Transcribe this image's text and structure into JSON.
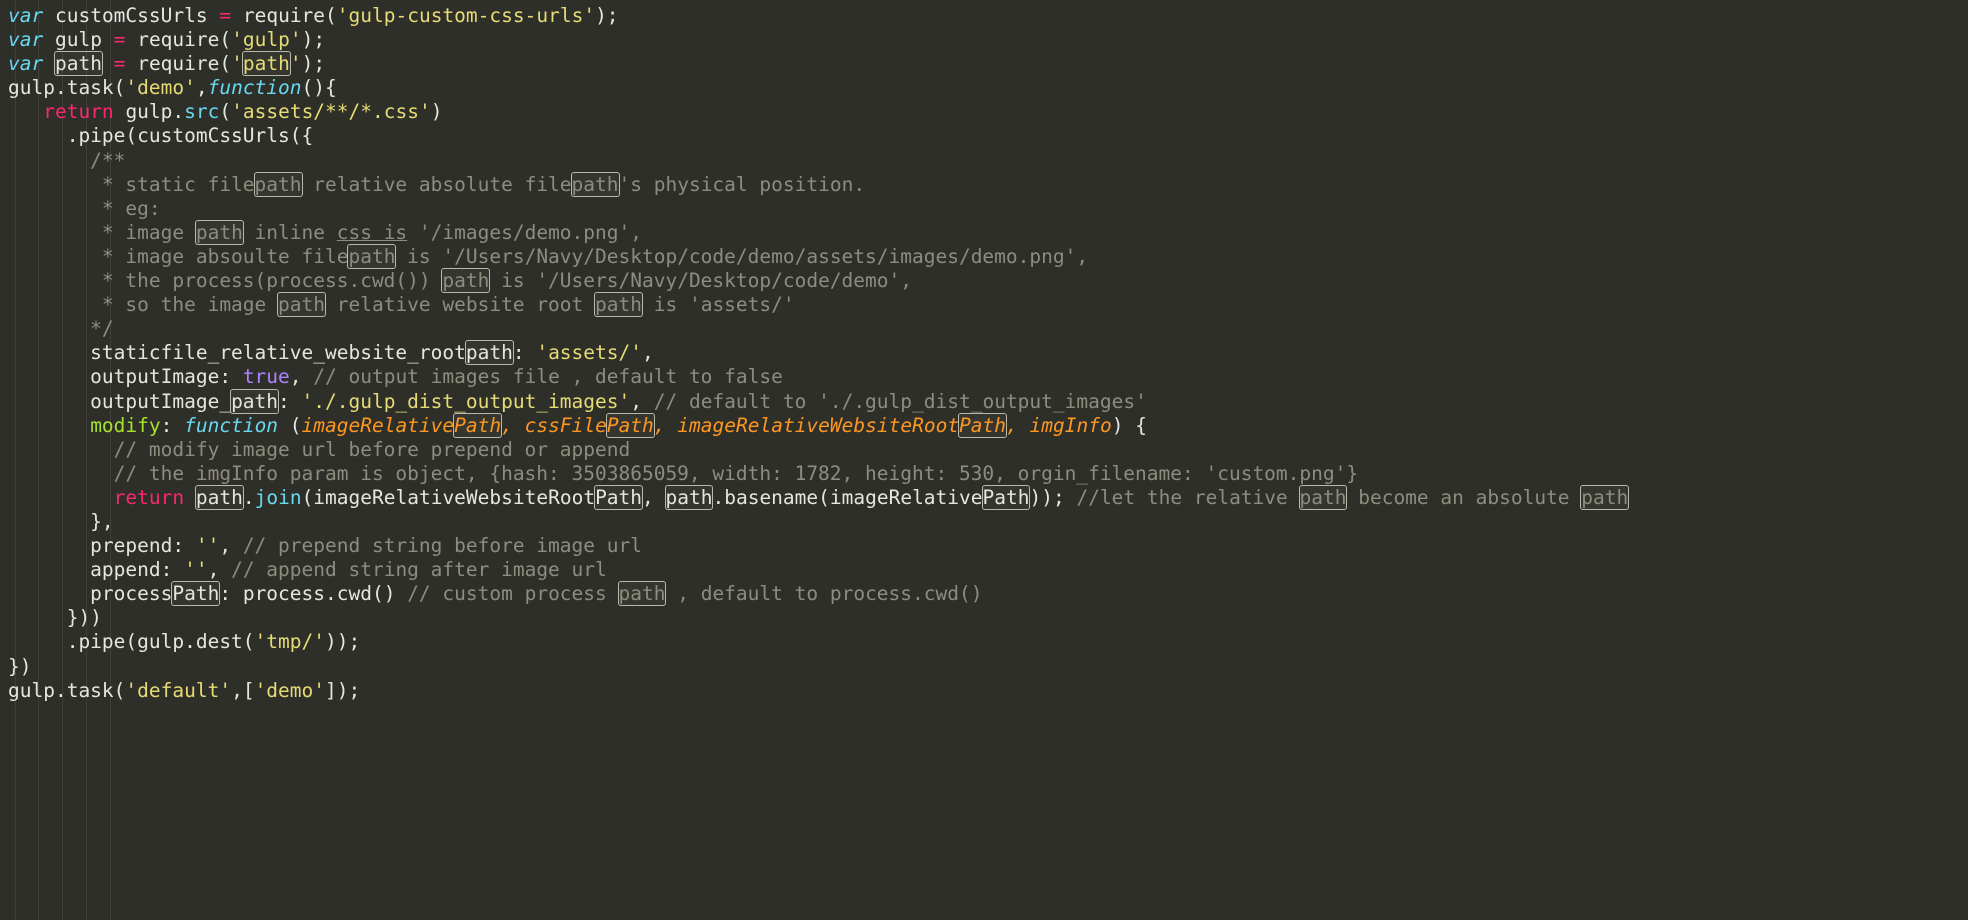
{
  "editor": {
    "language": "javascript",
    "filename": "gulpfile.js",
    "background_color": "#2f2f2a",
    "foreground_color": "#d8d8d2",
    "highlight_word": "path",
    "highlight_box_color": "#b9b9ac",
    "indent_guide_color": "#403f39",
    "font_size_px": 19.5,
    "line_height_px": 24.1,
    "tab_size": 2
  },
  "palette": {
    "keyword": "#67d8ef",
    "return": "#f92672",
    "operator": "#f92672",
    "string": "#e6db74",
    "method": "#66d9ef",
    "property": "#a6e22e",
    "parameter": "#fd971f",
    "comment": "#8d8d7f",
    "constant": "#ae81ff",
    "plain": "#e6e6e0"
  },
  "code": {
    "line_count": 29,
    "lines": [
      "var customCssUrls = require('gulp-custom-css-urls');",
      "var gulp = require('gulp');",
      "var path = require('path');",
      "gulp.task('demo',function(){",
      "   return gulp.src('assets/**/*.css')",
      "     .pipe(customCssUrls({",
      "       /**",
      "        * static filepath relative absolute filepath's physical position.",
      "        * eg:",
      "        * image path inline css is '/images/demo.png',",
      "        * image absoulte filepath is '/Users/Navy/Desktop/code/demo/assets/images/demo.png',",
      "        * the process(process.cwd()) path is '/Users/Navy/Desktop/code/demo',",
      "        * so the image path relative website root path is 'assets/'",
      "       */",
      "       staticfile_relative_website_rootpath: 'assets/',",
      "       outputImage: true, // output images file , default to false",
      "       outputImage_path: './.gulp_dist_output_images', // default to './.gulp_dist_output_images'",
      "       modify: function (imageRelativePath, cssFilePath, imageRelativeWebsiteRootPath, imgInfo) {",
      "         // modify image url before prepend or append",
      "         // the imgInfo param is object, {hash: 3503865059, width: 1782, height: 530, orgin_filename: 'custom.png'}",
      "         return path.join(imageRelativeWebsiteRootPath, path.basename(imageRelativePath)); //let the relative path become an absolute path",
      "       },",
      "       prepend: '', // prepend string before image url",
      "       append: '', // append string after image url",
      "       processPath: process.cwd() // custom process path , default to process.cwd()",
      "     }))",
      "     .pipe(gulp.dest('tmp/'));",
      "})",
      "gulp.task('default',['demo']);"
    ],
    "imgInfo_values": {
      "hash": "3503865059",
      "width": "1782",
      "height": "530",
      "orgin_filename": "custom.png"
    },
    "strings": [
      "gulp-custom-css-urls",
      "gulp",
      "path",
      "demo",
      "assets/**/*.css",
      "/images/demo.png",
      "/Users/Navy/Desktop/code/demo/assets/images/demo.png",
      "/Users/Navy/Desktop/code/demo",
      "assets/",
      "./.gulp_dist_output_images",
      "custom.png",
      "tmp/",
      "default"
    ],
    "option_keys": [
      "staticfile_relative_website_rootpath",
      "outputImage",
      "outputImage_path",
      "modify",
      "prepend",
      "append",
      "processPath"
    ],
    "modify_params": [
      "imageRelativePath",
      "cssFilePath",
      "imageRelativeWebsiteRootPath",
      "imgInfo"
    ]
  }
}
